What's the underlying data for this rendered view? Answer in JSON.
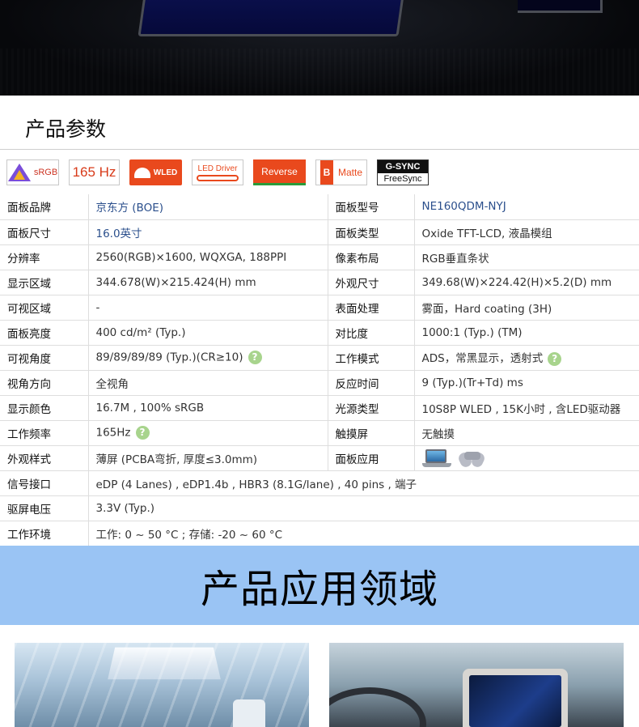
{
  "section_title": "产品参数",
  "badges": {
    "srgb": "sRGB",
    "hz": "165 Hz",
    "wled": "WLED",
    "led_driver": "LED Driver",
    "reverse": "Reverse",
    "matte_letter": "B",
    "matte": "Matte",
    "gsync": "G-SYNC",
    "freesync": "FreeSync"
  },
  "specs": [
    {
      "l1": "面板品牌",
      "v1": "京东方 (BOE)",
      "l2": "面板型号",
      "v2": "NE160QDM-NYJ"
    },
    {
      "l1": "面板尺寸",
      "v1": "16.0英寸",
      "l2": "面板类型",
      "v2": "Oxide TFT-LCD, 液晶模组"
    },
    {
      "l1": "分辨率",
      "v1": "2560(RGB)×1600, WQXGA, 188PPI",
      "l2": "像素布局",
      "v2": "RGB垂直条状"
    },
    {
      "l1": "显示区域",
      "v1": "344.678(W)×215.424(H) mm",
      "l2": "外观尺寸",
      "v2": "349.68(W)×224.42(H)×5.2(D) mm"
    },
    {
      "l1": "可视区域",
      "v1": "-",
      "l2": "表面处理",
      "v2": "雾面，Hard coating (3H)"
    },
    {
      "l1": "面板亮度",
      "v1": "400 cd/m² (Typ.)",
      "l2": "对比度",
      "v2": "1000:1 (Typ.) (TM)"
    },
    {
      "l1": "可视角度",
      "v1": "89/89/89/89 (Typ.)(CR≥10)",
      "l2": "工作模式",
      "v2": "ADS，常黑显示，透射式"
    },
    {
      "l1": "视角方向",
      "v1": "全视角",
      "l2": "反应时间",
      "v2": "9 (Typ.)(Tr+Td) ms"
    },
    {
      "l1": "显示颜色",
      "v1": "16.7M , 100% sRGB",
      "l2": "光源类型",
      "v2": "10S8P WLED , 15K小时 , 含LED驱动器"
    },
    {
      "l1": "工作频率",
      "v1": "165Hz",
      "l2": "触摸屏",
      "v2": "无触摸"
    },
    {
      "l1": "外观样式",
      "v1": "薄屏 (PCBA弯折, 厚度≤3.0mm)",
      "l2": "面板应用",
      "v2": ""
    },
    {
      "l1": "信号接口",
      "v1": "eDP (4 Lanes) , eDP1.4b , HBR3 (8.1G/lane) , 40 pins , 端子"
    },
    {
      "l1": "驱屏电压",
      "v1": "3.3V (Typ.)"
    },
    {
      "l1": "工作环境",
      "v1": "工作: 0 ~ 50 °C ; 存储: -20 ~ 60 °C"
    }
  ],
  "help_mark": "?",
  "banner_title": "产品应用领域",
  "icons": {
    "help": "question-mark-icon",
    "laptop": "laptop-icon",
    "gamepad": "gamepad-icon"
  },
  "colors": {
    "badge_orange": "#e9491d",
    "help_green": "#a8d48d",
    "banner_blue": "#9ac4f4",
    "model_blue": "#2b4f8c"
  }
}
